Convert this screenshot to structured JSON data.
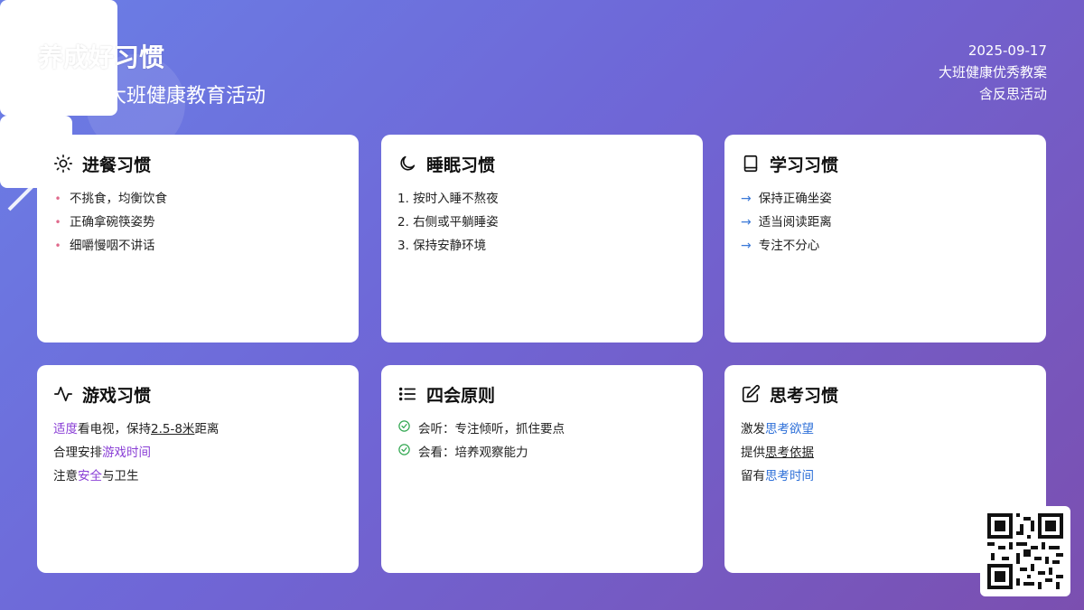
{
  "header": {
    "title": "养成好习惯",
    "subtitle": "大班健康教育活动",
    "meta_date": "2025-09-17",
    "meta_line2": "大班健康优秀教案",
    "meta_line3": "含反思活动"
  },
  "cards": [
    {
      "title": "进餐习惯",
      "icon": "sun-icon",
      "items": [
        "不挑食，均衡饮食",
        "正确拿碗筷姿势",
        "细嚼慢咽不讲话"
      ]
    },
    {
      "title": "睡眠习惯",
      "icon": "moon-icon",
      "items": [
        "1. 按时入睡不熬夜",
        "2. 右侧或平躺睡姿",
        "3. 保持安静环境"
      ]
    },
    {
      "title": "学习习惯",
      "icon": "book-icon",
      "items": [
        "保持正确坐姿",
        "适当阅读距离",
        "专注不分心"
      ]
    },
    {
      "title": "游戏习惯",
      "icon": "activity-icon",
      "items": [
        {
          "a": "适度",
          "b": "看电视，保持",
          "c": "2.5-8米",
          "d": "距离"
        },
        {
          "a": "合理安排",
          "b": "游戏时间"
        },
        {
          "a": "注意",
          "b": "安全",
          "c": "与卫生"
        }
      ]
    },
    {
      "title": "四会原则",
      "icon": "list-icon",
      "items": [
        "会听：专注倾听，抓住要点",
        "会看：培养观察能力"
      ]
    },
    {
      "title": "思考习惯",
      "icon": "edit-icon",
      "items": [
        {
          "a": "激发",
          "b": "思考欲望"
        },
        {
          "a": "提供",
          "b": "思考依据"
        },
        {
          "a": "留有",
          "b": "思考时间"
        }
      ]
    }
  ],
  "colors": {
    "bg_start": "#6a7fe6",
    "bg_end": "#7b4fb0",
    "accent_purple": "#8a3fd6",
    "accent_blue": "#2d6fd8",
    "bullet_pink": "#e06a8c",
    "check_green": "#34a853"
  },
  "qr_icon": "qr-code-icon"
}
